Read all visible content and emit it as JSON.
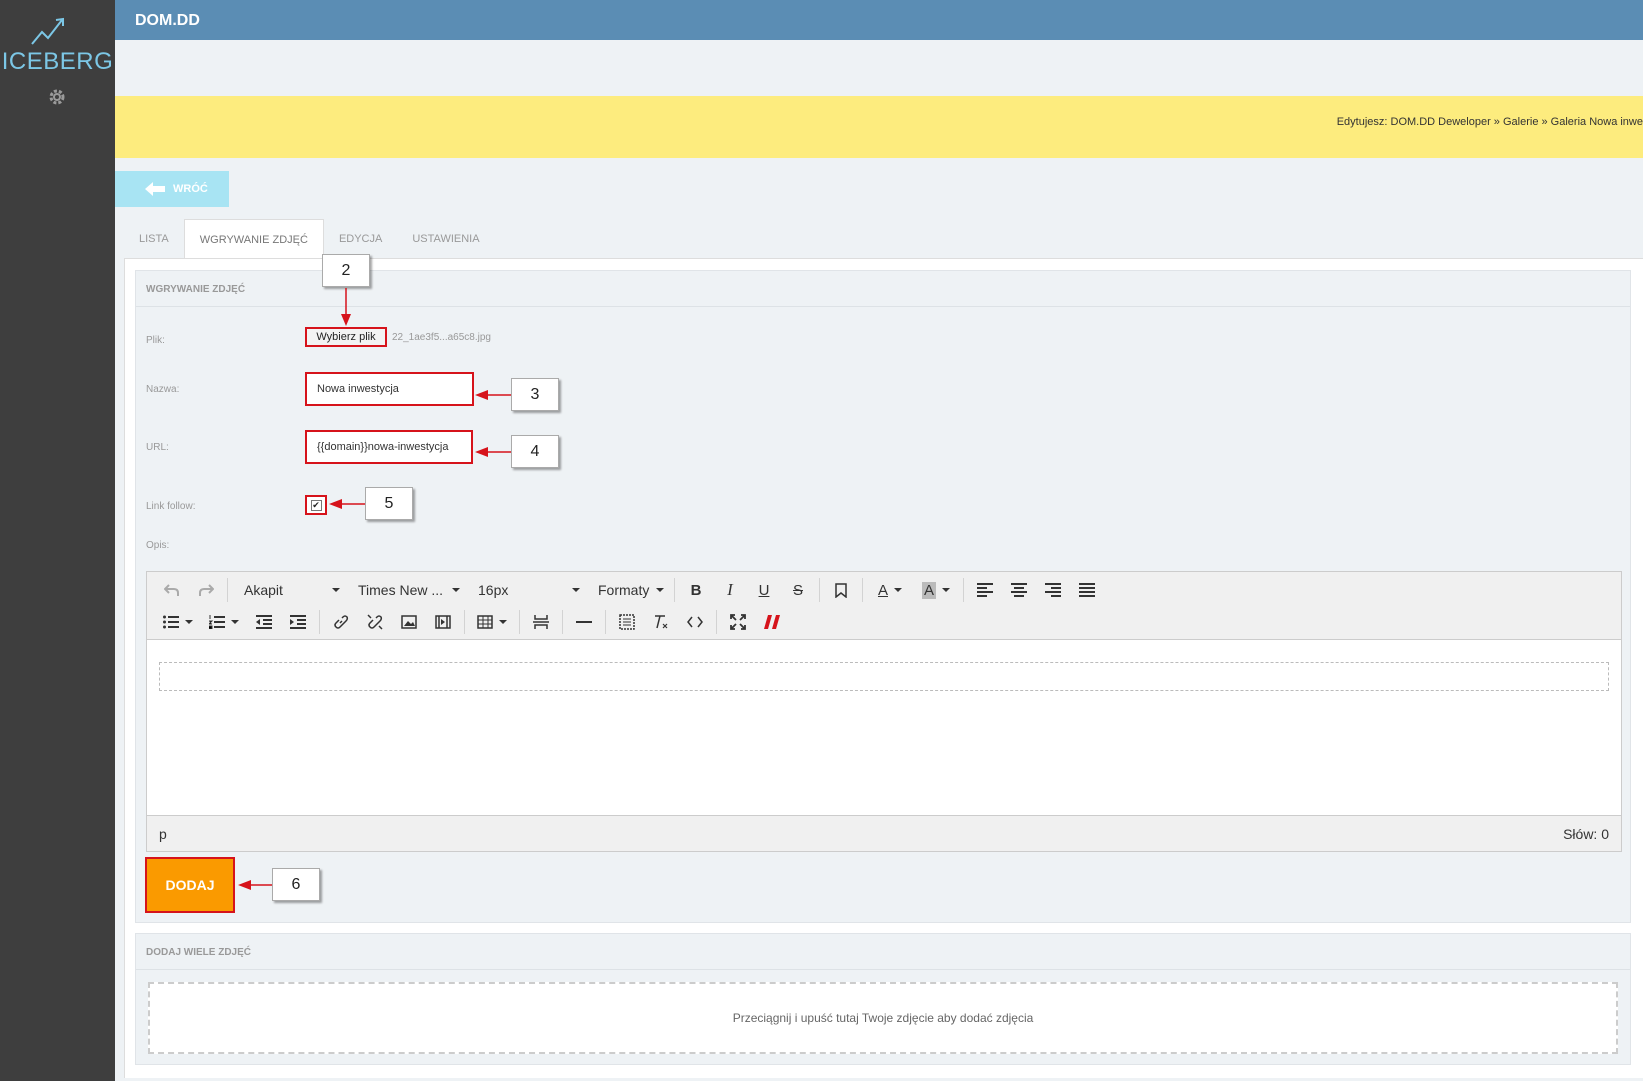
{
  "app": {
    "logo": "ICEBERG",
    "title": "DOM.DD"
  },
  "notice": {
    "text": "Edytujesz: DOM.DD Deweloper » Galerie » Galeria Nowa inwe"
  },
  "back": {
    "label": "WRÓĆ"
  },
  "tabs": [
    {
      "label": "LISTA"
    },
    {
      "label": "WGRYWANIE ZDJĘĆ"
    },
    {
      "label": "EDYCJA"
    },
    {
      "label": "USTAWIENIA"
    }
  ],
  "upload": {
    "section_title": "WGRYWANIE ZDJĘĆ",
    "file_label": "Plik:",
    "file_button": "Wybierz plik",
    "file_name": "22_1ae3f5...a65c8.jpg",
    "name_label": "Nazwa:",
    "name_value": "Nowa inwestycja",
    "url_label": "URL:",
    "url_value": "{{domain}}nowa-inwestycja",
    "follow_label": "Link follow:",
    "follow_checked": true,
    "desc_label": "Opis:",
    "submit": "DODAJ"
  },
  "editor": {
    "block_format": "Akapit",
    "font_family": "Times New ...",
    "font_size": "16px",
    "formats": "Formaty",
    "path": "p",
    "word_count": "Słów: 0"
  },
  "callouts": {
    "c2": "2",
    "c3": "3",
    "c4": "4",
    "c5": "5",
    "c6": "6"
  },
  "multi": {
    "section_title": "DODAJ WIELE ZDJĘĆ",
    "dropzone": "Przeciągnij i upuść tutaj Twoje zdjęcie aby dodać zdjęcia"
  },
  "colors": {
    "sidebar": "#3e3e3e",
    "topbar": "#5b8db4",
    "notice": "#fdec7e",
    "accent": "#fa9a00",
    "annotation": "#d6131b"
  }
}
